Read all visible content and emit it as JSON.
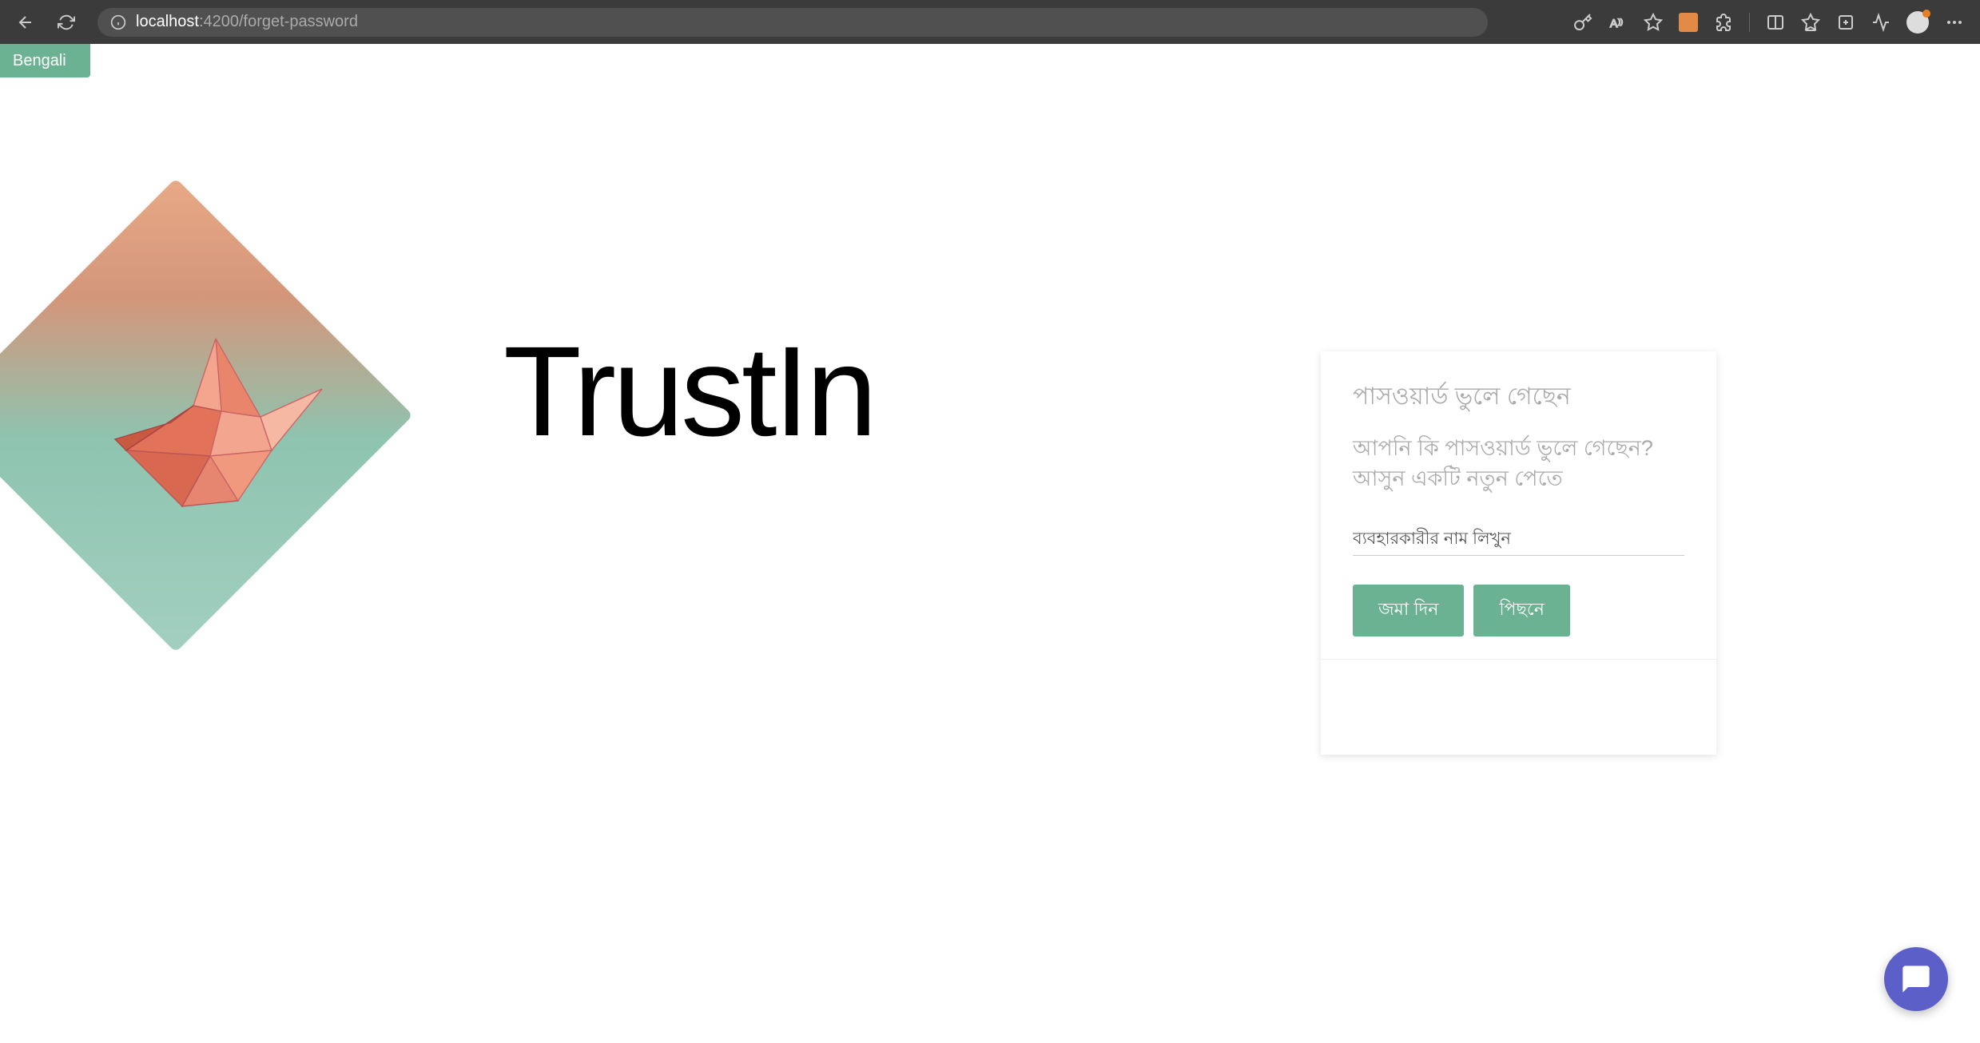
{
  "browser": {
    "url_host": "localhost",
    "url_port_path": ":4200/forget-password"
  },
  "language_selector": {
    "selected": "Bengali"
  },
  "brand": {
    "name": "TrustIn"
  },
  "form": {
    "title": "পাসওয়ার্ড ভুলে গেছেন",
    "subtitle": "আপনি কি পাসওয়ার্ড ভুলে গেছেন? আসুন একটি নতুন পেতে",
    "username_placeholder": "ব্যবহারকারীর নাম লিখুন",
    "submit_label": "জমা দিন",
    "back_label": "পিছনে"
  }
}
